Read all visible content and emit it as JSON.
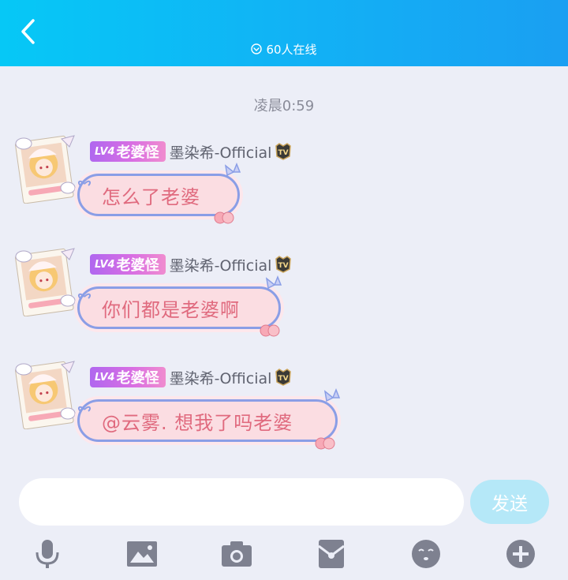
{
  "header": {
    "online_text": "60人在线",
    "gradient_start": "#06c8f6",
    "gradient_end": "#1a9ff2"
  },
  "timestamp": "凌晨0:59",
  "messages": [
    {
      "level": "LV4",
      "title": "老婆怪",
      "username": "墨染希-Official",
      "badge_icon": "tv-icon",
      "text": "怎么了老婆"
    },
    {
      "level": "LV4",
      "title": "老婆怪",
      "username": "墨染希-Official",
      "badge_icon": "tv-icon",
      "text": "你们都是老婆啊"
    },
    {
      "level": "LV4",
      "title": "老婆怪",
      "username": "墨染希-Official",
      "badge_icon": "tv-icon",
      "text": "@云雾. 想我了吗老婆"
    }
  ],
  "input": {
    "placeholder": "",
    "value": "",
    "send_label": "发送"
  },
  "toolbar": [
    "microphone-icon",
    "image-icon",
    "camera-icon",
    "red-packet-icon",
    "emoji-icon",
    "plus-icon"
  ],
  "colors": {
    "background": "#eceef7",
    "bubble_fill": "#fbdde2",
    "bubble_border": "#8a9ee6",
    "bubble_text": "#e06a7e",
    "send_button": "#b5e8f8",
    "icon_gray": "#7e8190"
  }
}
